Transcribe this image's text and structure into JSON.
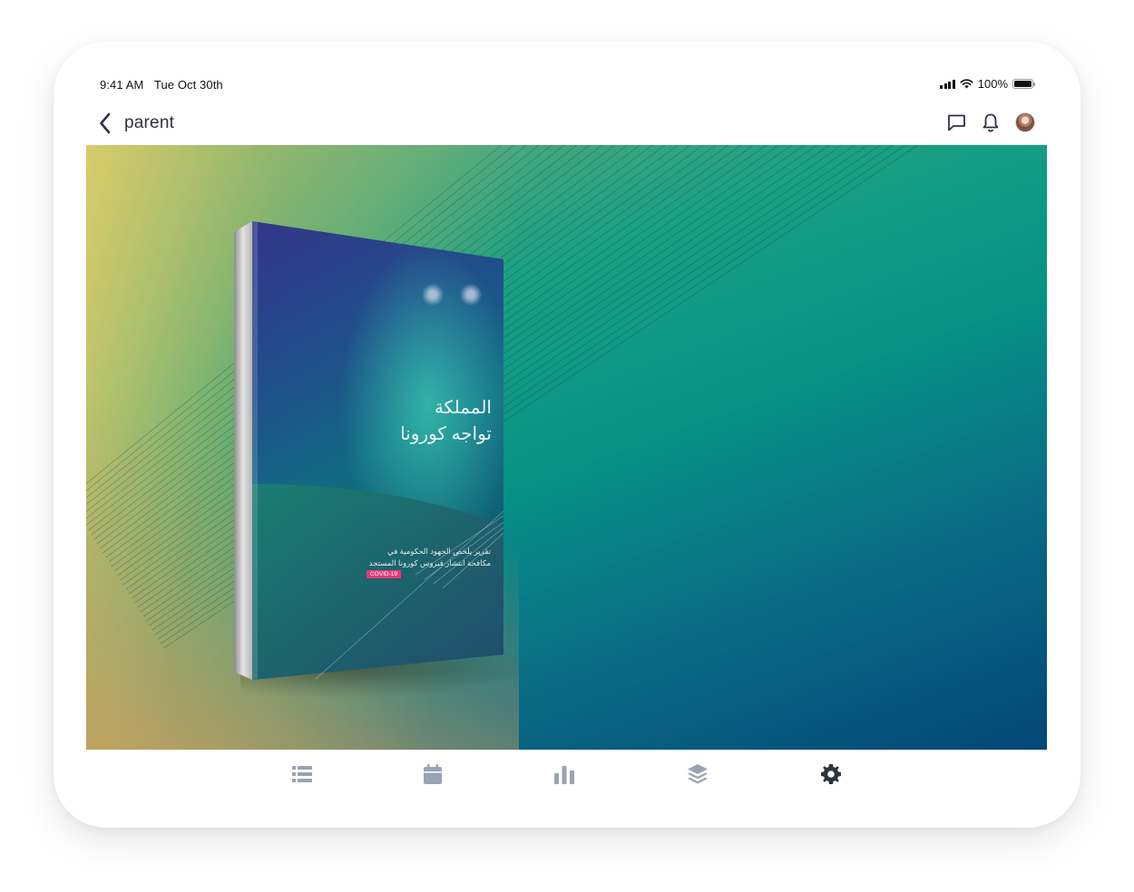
{
  "status_bar": {
    "time": "9:41 AM",
    "date": "Tue Oct 30th",
    "battery": "100%"
  },
  "nav": {
    "back_label": "parent",
    "icons": [
      "chevron-left-icon",
      "chat-icon",
      "bell-icon",
      "avatar"
    ]
  },
  "content": {
    "cover_title_line1": "المملكة",
    "cover_title_line2": "تواجه كورونا",
    "cover_subtitle_line1": "تقرير يلخص الجهود الحكومية في",
    "cover_subtitle_line2": "مكافحة انتشار فيروس كورونا المستجد",
    "cover_badge": "COVID-19"
  },
  "tabbar": {
    "tabs": [
      {
        "icon": "list-icon",
        "active": false
      },
      {
        "icon": "calendar-icon",
        "active": false
      },
      {
        "icon": "bar-chart-icon",
        "active": false
      },
      {
        "icon": "layers-icon",
        "active": false
      },
      {
        "icon": "gear-icon",
        "active": true
      }
    ]
  },
  "colors": {
    "tab_inactive": "#9aa3b5",
    "tab_active": "#2d3142",
    "nav_text": "#2d3142",
    "badge": "#e23c7a"
  }
}
